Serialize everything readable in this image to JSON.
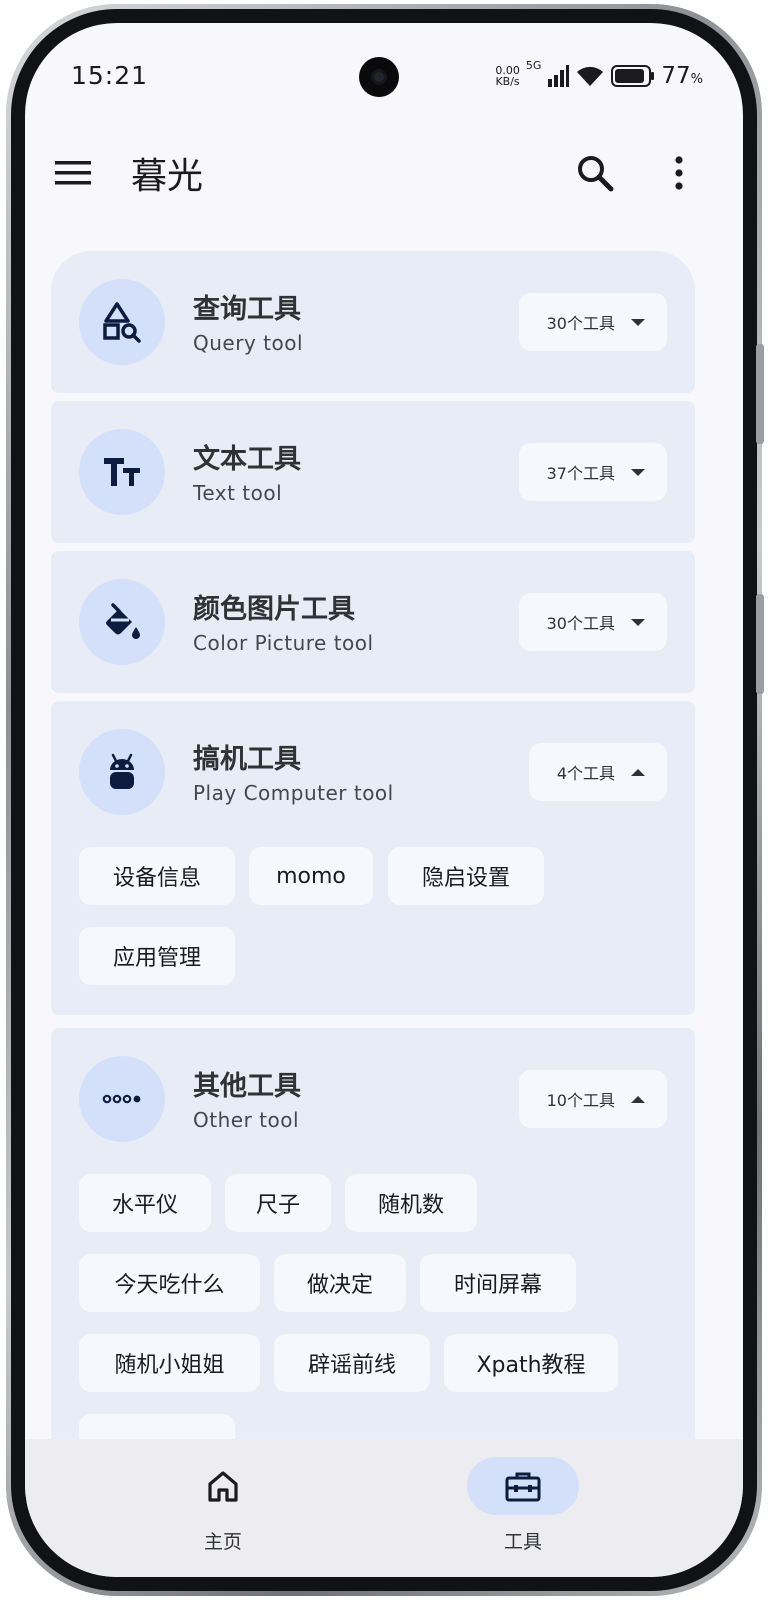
{
  "status_bar": {
    "time": "15:21",
    "net_speed_value": "0.00",
    "net_speed_unit": "KB/s",
    "network": "5G",
    "battery_percent": "77",
    "battery_unit": "%"
  },
  "app_bar": {
    "title": "暮光",
    "menu_icon": "menu-icon",
    "search_icon": "search-icon",
    "more_icon": "more-vert-icon"
  },
  "categories": [
    {
      "title": "查询工具",
      "subtitle": "Query tool",
      "count": "30个工具",
      "icon": "shapes-search-icon",
      "expanded": false
    },
    {
      "title": "文本工具",
      "subtitle": "Text tool",
      "count": "37个工具",
      "icon": "text-fields-icon",
      "expanded": false
    },
    {
      "title": "颜色图片工具",
      "subtitle": "Color Picture tool",
      "count": "30个工具",
      "icon": "paint-bucket-icon",
      "expanded": false
    },
    {
      "title": "搞机工具",
      "subtitle": "Play Computer tool",
      "count": "4个工具",
      "icon": "android-icon",
      "expanded": true,
      "tools": [
        "设备信息",
        "momo",
        "隐启设置",
        "应用管理"
      ]
    },
    {
      "title": "其他工具",
      "subtitle": "Other tool",
      "count": "10个工具",
      "icon": "dots-icon",
      "expanded": true,
      "tools": [
        "水平仪",
        "尺子",
        "随机数",
        "今天吃什么",
        "做决定",
        "时间屏幕",
        "随机小姐姐",
        "辟谣前线",
        "Xpath教程"
      ]
    }
  ],
  "bottom_nav": {
    "items": [
      {
        "label": "主页",
        "icon": "home-icon",
        "active": false
      },
      {
        "label": "工具",
        "icon": "toolbox-icon",
        "active": true
      }
    ]
  },
  "colors": {
    "background": "#f7f7fc",
    "card": "#e8ecf6",
    "icon_circle": "#d4e0fa",
    "icon_fg": "#0d1b3e",
    "active_pill": "#d4e0fa"
  }
}
